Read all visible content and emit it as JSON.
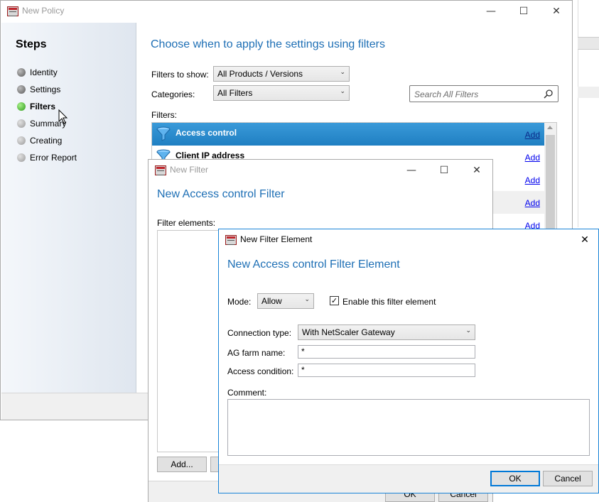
{
  "policy_window": {
    "title": "New Policy",
    "steps_header": "Steps",
    "steps": [
      {
        "label": "Identity",
        "state": "done"
      },
      {
        "label": "Settings",
        "state": "done"
      },
      {
        "label": "Filters",
        "state": "active"
      },
      {
        "label": "Summary",
        "state": "todo"
      },
      {
        "label": "Creating",
        "state": "todo"
      },
      {
        "label": "Error Report",
        "state": "todo"
      }
    ],
    "heading": "Choose when to apply the settings using filters",
    "filters_to_show_label": "Filters to show:",
    "filters_to_show_value": "All Products / Versions",
    "categories_label": "Categories:",
    "categories_value": "All Filters",
    "search_placeholder": "Search All Filters",
    "filters_label": "Filters:",
    "filter_rows": [
      {
        "name": "Access control",
        "action": "Add",
        "selected": true
      },
      {
        "name": "Client IP address",
        "action": "Add",
        "selected": false
      },
      {
        "name": "",
        "action": "Add",
        "selected": false
      },
      {
        "name": "",
        "action": "Add",
        "selected": false
      },
      {
        "name": "",
        "action": "Add",
        "selected": false
      }
    ]
  },
  "filter_window": {
    "title": "New Filter",
    "heading": "New Access control Filter",
    "filter_elements_label": "Filter elements:",
    "add_button": "Add...",
    "ok_button": "OK",
    "cancel_button": "Cancel"
  },
  "element_dialog": {
    "title": "New Filter Element",
    "heading": "New Access control Filter Element",
    "mode_label": "Mode:",
    "mode_value": "Allow",
    "enable_label": "Enable this filter element",
    "enable_checked": true,
    "connection_type_label": "Connection type:",
    "connection_type_value": "With NetScaler Gateway",
    "ag_farm_label": "AG farm name:",
    "ag_farm_value": "*",
    "access_condition_label": "Access condition:",
    "access_condition_value": "*",
    "comment_label": "Comment:",
    "comment_value": "",
    "ok_button": "OK",
    "cancel_button": "Cancel"
  },
  "window_controls": {
    "minimize": "—",
    "maximize": "☐",
    "close": "✕"
  },
  "colors": {
    "accent": "#1e6fb5",
    "selected_row": "#2b8ad0",
    "link": "#0000ee"
  }
}
